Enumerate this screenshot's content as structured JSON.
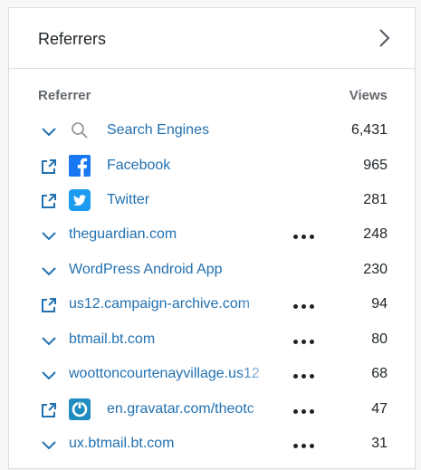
{
  "card": {
    "title": "Referrers",
    "column_referrer": "Referrer",
    "column_views": "Views"
  },
  "rows": [
    {
      "label": "Search Engines",
      "views": "6,431",
      "lead": "chevron-down-icon",
      "favicon": "search-icon",
      "more": false
    },
    {
      "label": "Facebook",
      "views": "965",
      "lead": "external-link-icon",
      "favicon": "facebook-icon",
      "more": false
    },
    {
      "label": "Twitter",
      "views": "281",
      "lead": "external-link-icon",
      "favicon": "twitter-icon",
      "more": false
    },
    {
      "label": "theguardian.com",
      "views": "248",
      "lead": "chevron-down-icon",
      "favicon": null,
      "more": true
    },
    {
      "label": "WordPress Android App",
      "views": "230",
      "lead": "chevron-down-icon",
      "favicon": null,
      "more": false
    },
    {
      "label": "us12.campaign-archive.com",
      "views": "94",
      "lead": "external-link-icon",
      "favicon": null,
      "more": true
    },
    {
      "label": "btmail.bt.com",
      "views": "80",
      "lead": "chevron-down-icon",
      "favicon": null,
      "more": true
    },
    {
      "label": "woottoncourtenayvillage.us12",
      "views": "68",
      "lead": "chevron-down-icon",
      "favicon": null,
      "more": true
    },
    {
      "label": "en.gravatar.com/theotc",
      "views": "47",
      "lead": "external-link-icon",
      "favicon": "gravatar-icon",
      "more": true
    },
    {
      "label": "ux.btmail.bt.com",
      "views": "31",
      "lead": "chevron-down-icon",
      "favicon": null,
      "more": true
    }
  ],
  "colors": {
    "link": "#2271b1",
    "facebook": "#1877f2",
    "twitter": "#1d9bf0",
    "gravatar": "#1e8cbe"
  }
}
